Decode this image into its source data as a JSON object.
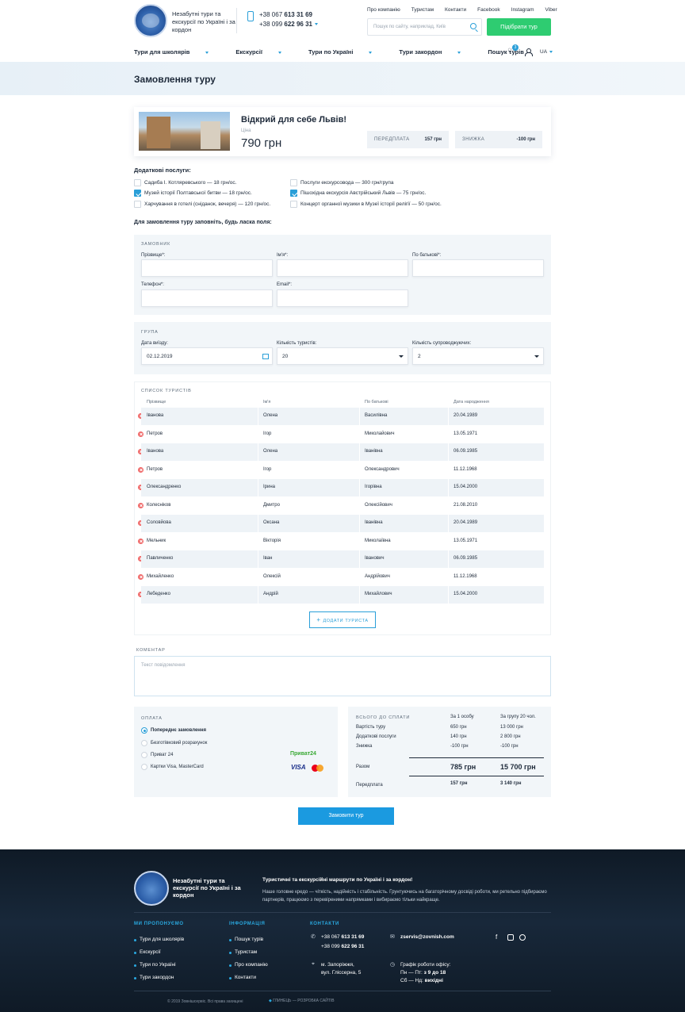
{
  "header": {
    "tagline": "Незабутні тури та екскурсії по Україні і за кордон",
    "phone1_prefix": "+38 067 ",
    "phone1_bold": "613 31 69",
    "phone2_prefix": "+38 099 ",
    "phone2_bold": "622 96 31",
    "top_links": [
      "Про компанію",
      "Туристам",
      "Контакти",
      "Facebook",
      "Instagram",
      "Viber"
    ],
    "search_placeholder": "Пошук по сайту, наприклад, Київ",
    "cta": "Підібрати тур",
    "nav": [
      "Тури для школярів",
      "Екскурсії",
      "Тури по Україні",
      "Тури закордон",
      "Пошук турів"
    ],
    "favorites_count": "3",
    "lang": "UA"
  },
  "page_title": "Замовлення туру",
  "tour": {
    "title": "Відкрий для себе Львів!",
    "price_label": "Ціна",
    "price": "790 грн",
    "prepay_label": "ПЕРЕДПЛАТА",
    "prepay_value": "157 грн",
    "discount_label": "ЗНИЖКА",
    "discount_value": "-100 грн"
  },
  "services": {
    "title": "Додаткові послуги:",
    "items": [
      {
        "label": "Садиба І. Котляревського — 18 грн/ос.",
        "checked": false
      },
      {
        "label": "Музей історії Полтавської битви — 18 грн/ос.",
        "checked": true
      },
      {
        "label": "Харчування в готелі (сніданок, вечеря) — 120 грн/ос.",
        "checked": false
      },
      {
        "label": "Послуги екскурсовода — 300 грн/група",
        "checked": false
      },
      {
        "label": "Пішохідна екскурсія Австрійський Львів — 75 грн/ос.",
        "checked": true
      },
      {
        "label": "Концерт органної музики в Музеї історії релігії — 50 грн/ос.",
        "checked": false
      }
    ]
  },
  "form_intro": "Для замовлення туру заповніть, будь ласка поля:",
  "customer": {
    "caption": "ЗАМОВНИК",
    "surname_label": "Прізвище*:",
    "name_label": "Ім'я*:",
    "patronymic_label": "По батькові*:",
    "phone_label": "Телефон*:",
    "email_label": "Email*:"
  },
  "group": {
    "caption": "ГРУПА",
    "date_label": "Дата виїзду:",
    "date_value": "02.12.2019",
    "tourists_label": "Кількість туристів:",
    "tourists_value": "20",
    "escorts_label": "Кількість супроводжуючих:",
    "escorts_value": "2"
  },
  "tourists": {
    "caption": "СПИСОК ТУРИСТІВ",
    "columns": [
      "Прізвище",
      "Ім'я",
      "По батькові",
      "Дата народження"
    ],
    "rows": [
      [
        "Іванова",
        "Олена",
        "Василівна",
        "20.04.1989"
      ],
      [
        "Петров",
        "Ігор",
        "Миколайович",
        "13.05.1971"
      ],
      [
        "Іванова",
        "Олена",
        "Іванівна",
        "06.09.1985"
      ],
      [
        "Петров",
        "Ігор",
        "Олександрович",
        "11.12.1968"
      ],
      [
        "Олександренко",
        "Ірина",
        "Ігорівна",
        "15.04.2000"
      ],
      [
        "Колесніков",
        "Дмитро",
        "Олексійович",
        "21.08.2010"
      ],
      [
        "Соловйова",
        "Оксана",
        "Іванівна",
        "20.04.1989"
      ],
      [
        "Мельник",
        "Вікторія",
        "Миколаївна",
        "13.05.1971"
      ],
      [
        "Павличенко",
        "Іван",
        "Іванович",
        "06.09.1985"
      ],
      [
        "Михайленко",
        "Олексій",
        "Андрійович",
        "11.12.1968"
      ],
      [
        "Лебеденко",
        "Андрій",
        "Михайлович",
        "15.04.2000"
      ]
    ],
    "add_label": "ДОДАТИ ТУРИСТА"
  },
  "comment": {
    "caption": "КОМЕНТАР",
    "placeholder": "Текст повідомлення"
  },
  "payment": {
    "caption": "ОПЛАТА",
    "options": [
      {
        "label": "Попереднє замовлення",
        "selected": true
      },
      {
        "label": "Безготівковий розрахунок",
        "selected": false
      },
      {
        "label": "Приват 24",
        "selected": false
      },
      {
        "label": "Картки Visa, MasterCard",
        "selected": false
      }
    ],
    "privat_logo": "Приват24",
    "visa_logo": "VISA"
  },
  "summary": {
    "caption": "ВСЬОГО ДО СПЛАТИ",
    "col1": "За 1 особу",
    "col2": "За групу 20 чол.",
    "rows": [
      [
        "Вартість туру",
        "650 грн",
        "13 000 грн"
      ],
      [
        "Додаткові послуги",
        "140 грн",
        "2 800 грн"
      ],
      [
        "Знижка",
        "-100 грн",
        "-100 грн"
      ]
    ],
    "total_label": "Разом",
    "total1": "785 грн",
    "total2": "15 700 грн",
    "prepay_label": "Передплата",
    "prepay1": "157 грн",
    "prepay2": "3 140 грн"
  },
  "submit": "Замовити тур",
  "footer": {
    "tagline": "Незабутні тури та екскурсії по Україні і за кордон",
    "headline": "Туристичні та екскурсійні маршрути по Україні і за кордон!",
    "desc": "Наше головне кредо — чіткість, надійність і стабільність. Грунтуючись на багаторічному досвіді роботи, ми ретельно підбираємо партнерів, працюємо з перевіреними напрямками і вибираємо тільки найкраще.",
    "offer_caption": "МИ ПРОПОНУЄМО",
    "offer_links": [
      "Тури для школярів",
      "Екскурсії",
      "Тури по Україні",
      "Тури закордон"
    ],
    "info_caption": "ІНФОРМАЦІЯ",
    "info_links": [
      "Пошук турів",
      "Туристам",
      "Про компанію",
      "Контакти"
    ],
    "contacts_caption": "КОНТАКТИ",
    "phone1_prefix": "+38 067 ",
    "phone1_bold": "613 31 69",
    "phone2_prefix": "+38 099 ",
    "phone2_bold": "622 96 31",
    "email": "zservis@zovnish.com",
    "address1": "м. Запоріжжя,",
    "address2": "вул. Гліссерна, 5",
    "schedule_title": "Графік роботи офісу:",
    "schedule1_prefix": "Пн — Пт: ",
    "schedule1_bold": "з 9 до 18",
    "schedule2_prefix": "Сб — Нд: ",
    "schedule2_bold": "вихідні",
    "copyright": "© 2019 Зовнішсервіс. Всі права захищені",
    "dev": "ГЛИНЕЦЬ — РОЗРОБКА САЙТІВ"
  }
}
